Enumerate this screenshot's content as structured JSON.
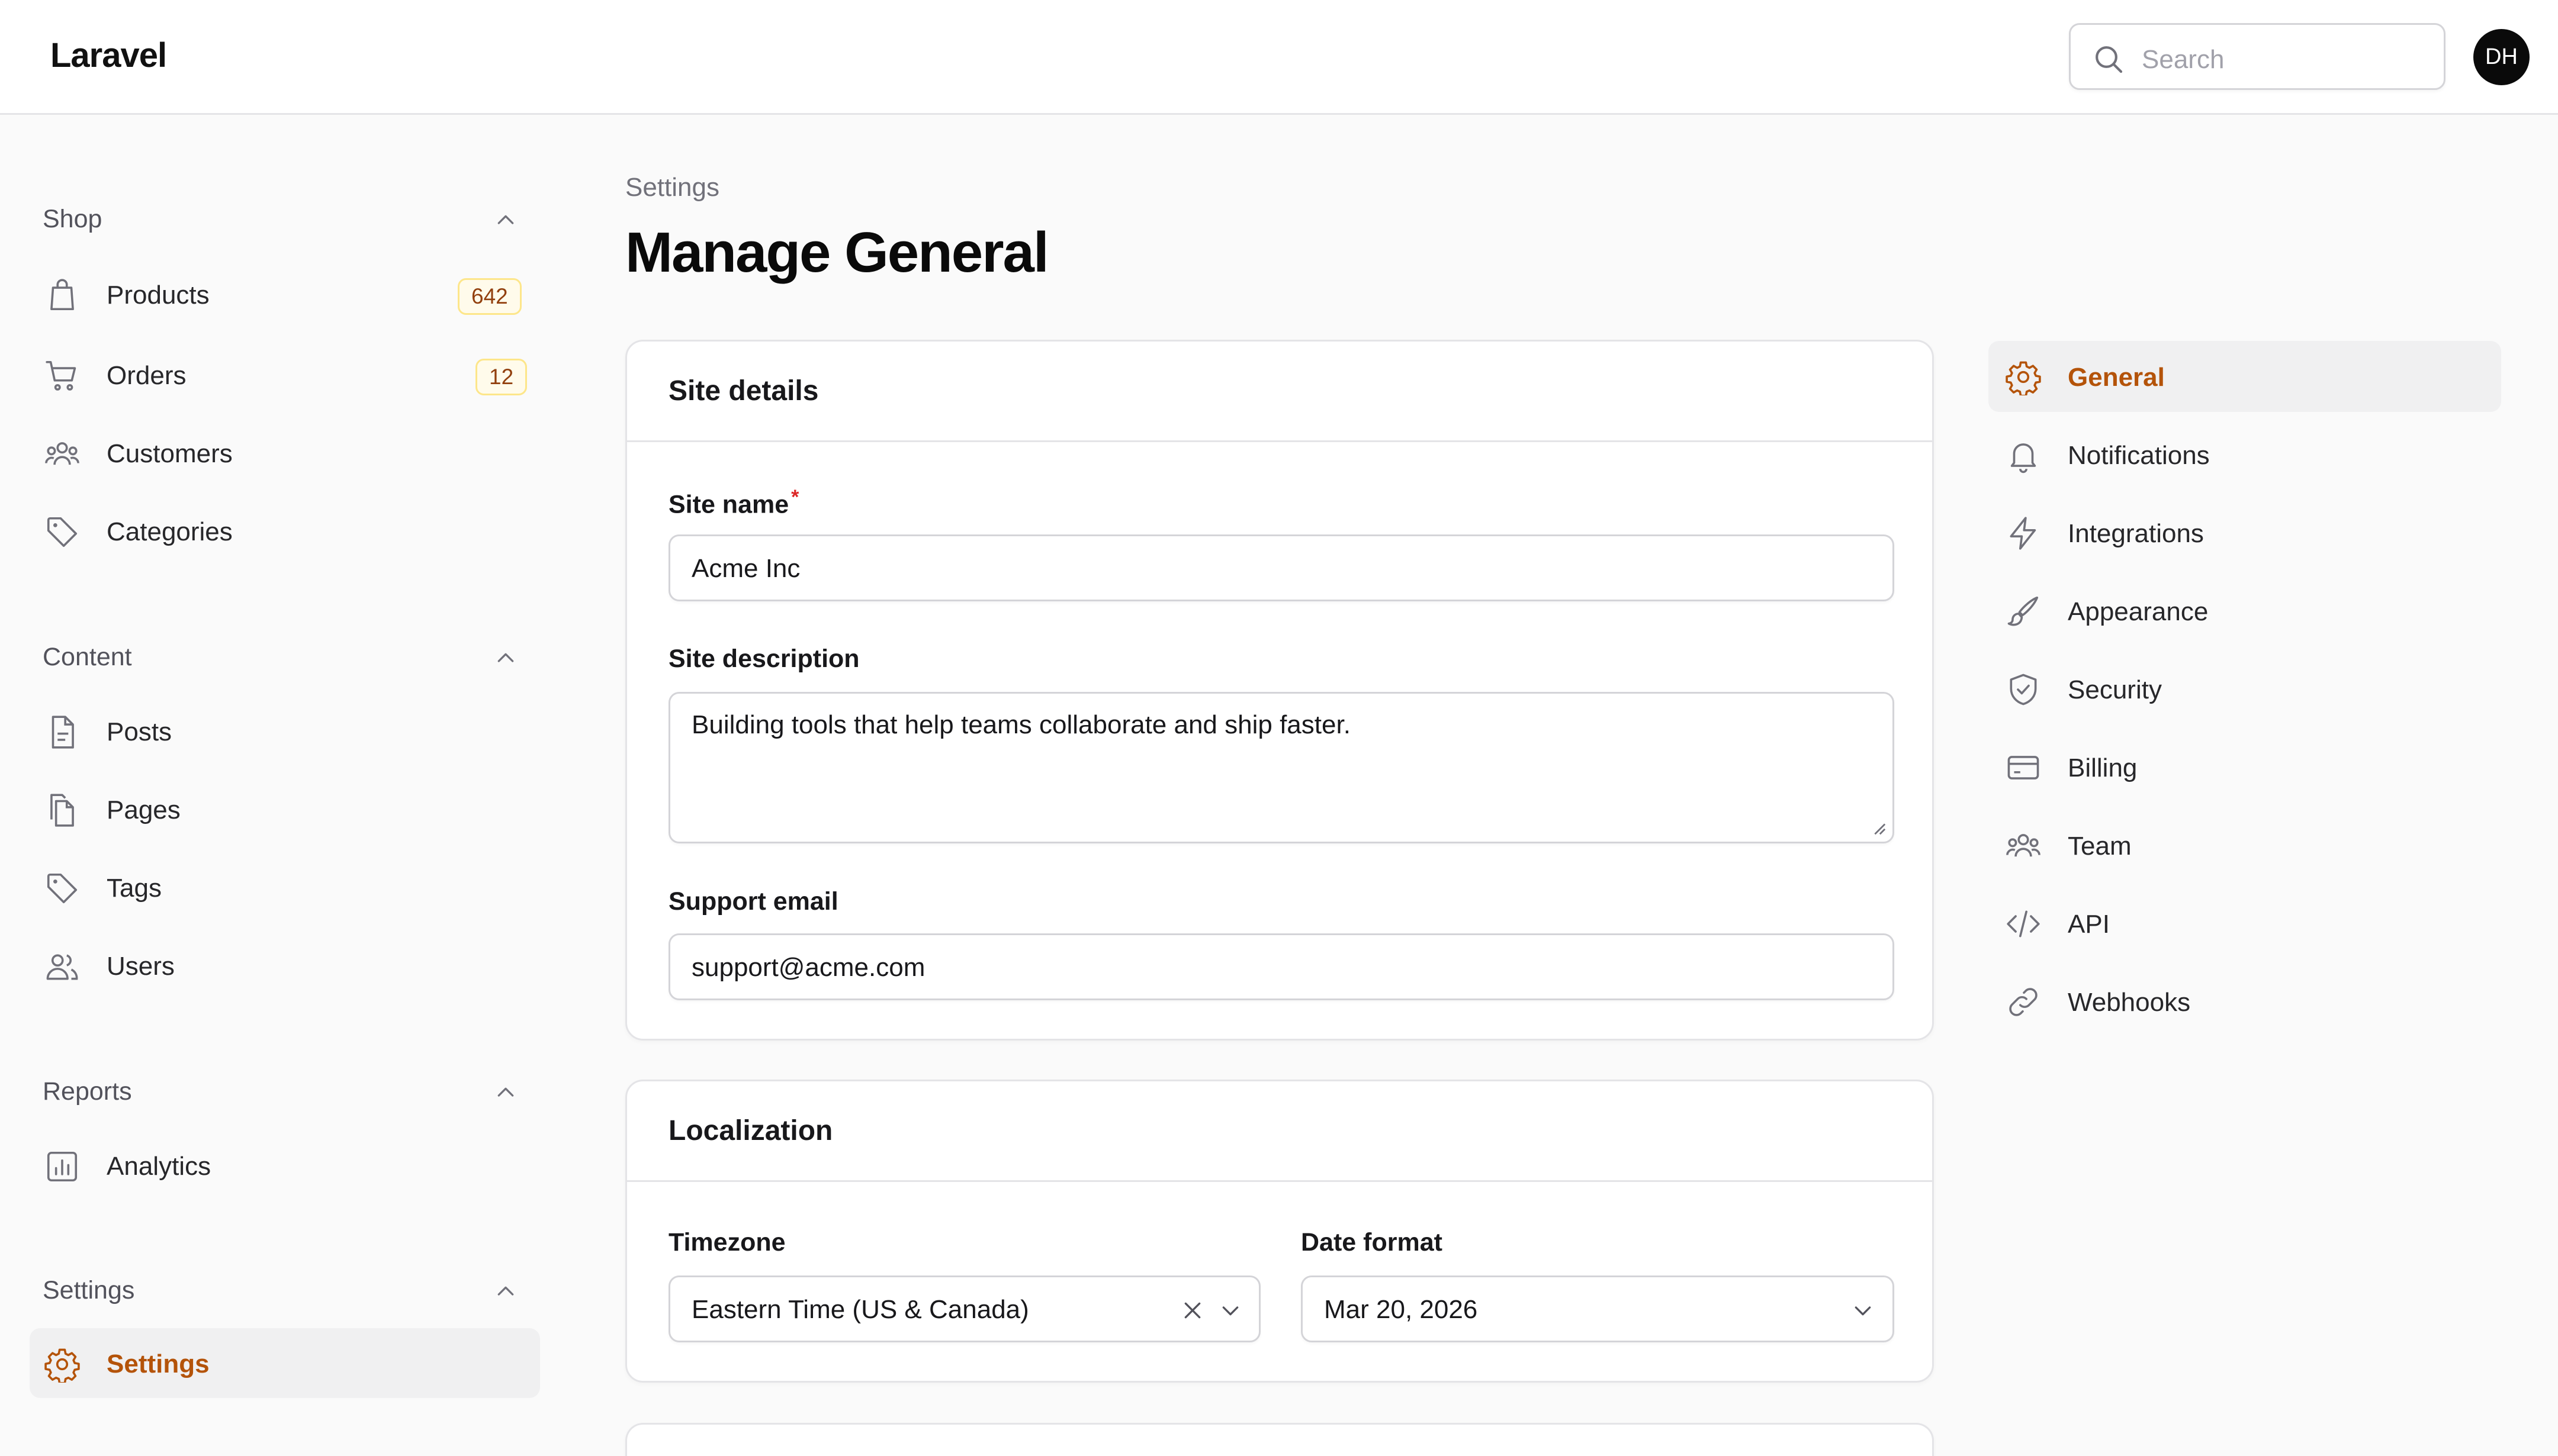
{
  "app": {
    "brand": "Laravel"
  },
  "header": {
    "search_placeholder": "Search",
    "user_initials": "DH"
  },
  "sidebar": {
    "groups": [
      {
        "label": "Shop",
        "items": [
          {
            "label": "Products",
            "icon": "shopping-bag-icon",
            "badge": "642"
          },
          {
            "label": "Orders",
            "icon": "shopping-cart-icon",
            "badge": "12"
          },
          {
            "label": "Customers",
            "icon": "users-group-icon"
          },
          {
            "label": "Categories",
            "icon": "tag-icon"
          }
        ]
      },
      {
        "label": "Content",
        "items": [
          {
            "label": "Posts",
            "icon": "document-icon"
          },
          {
            "label": "Pages",
            "icon": "documents-icon"
          },
          {
            "label": "Tags",
            "icon": "tag-icon"
          },
          {
            "label": "Users",
            "icon": "users-icon"
          }
        ]
      },
      {
        "label": "Reports",
        "items": [
          {
            "label": "Analytics",
            "icon": "chart-bar-icon"
          }
        ]
      },
      {
        "label": "Settings",
        "items": [
          {
            "label": "Settings",
            "icon": "gear-icon",
            "active": true
          }
        ]
      }
    ]
  },
  "main": {
    "breadcrumb": "Settings",
    "title": "Manage General",
    "site_details": {
      "title": "Site details",
      "site_name_label": "Site name",
      "required_mark": "*",
      "site_name_value": "Acme Inc",
      "site_description_label": "Site description",
      "site_description_value": "Building tools that help teams collaborate and ship faster.",
      "support_email_label": "Support email",
      "support_email_value": "support@acme.com"
    },
    "localization": {
      "title": "Localization",
      "timezone_label": "Timezone",
      "timezone_value": "Eastern Time (US & Canada)",
      "date_format_label": "Date format",
      "date_format_value": "Mar 20, 2026"
    }
  },
  "settings_nav": {
    "items": [
      {
        "label": "General",
        "icon": "gear-icon",
        "active": true
      },
      {
        "label": "Notifications",
        "icon": "bell-icon"
      },
      {
        "label": "Integrations",
        "icon": "bolt-icon"
      },
      {
        "label": "Appearance",
        "icon": "paint-brush-icon"
      },
      {
        "label": "Security",
        "icon": "shield-check-icon"
      },
      {
        "label": "Billing",
        "icon": "credit-card-icon"
      },
      {
        "label": "Team",
        "icon": "users-group-icon"
      },
      {
        "label": "API",
        "icon": "code-icon"
      },
      {
        "label": "Webhooks",
        "icon": "link-icon"
      }
    ]
  },
  "colors": {
    "accent": "#b45309",
    "badge_bg": "#fffbeb",
    "badge_border": "#fde68a",
    "required": "#dc2626"
  }
}
